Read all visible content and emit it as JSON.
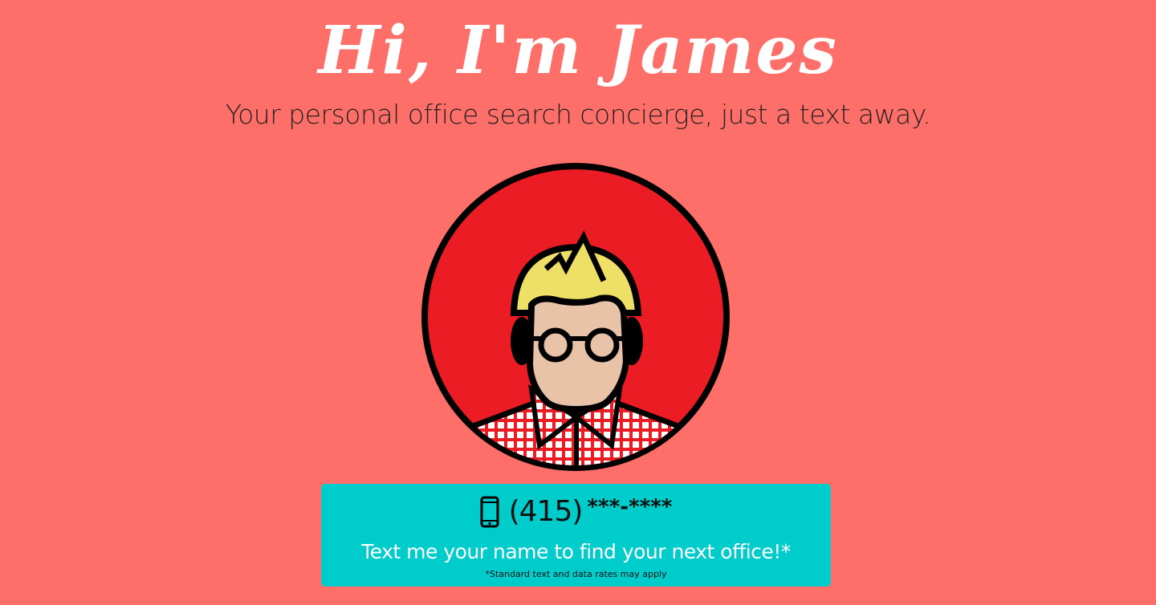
{
  "header": {
    "title": "Hi, I'm James",
    "subtitle": "Your personal office search concierge, just a text away."
  },
  "avatar": {
    "icon": "cartoon-avatar-icon"
  },
  "cta": {
    "phone_icon": "mobile-phone-icon",
    "area_code": "(415)",
    "masked_number": "***-****",
    "message": "Text me your name to find your next office!*",
    "disclaimer": "*Standard text and data rates may apply"
  },
  "colors": {
    "background": "#ff6f69",
    "cta": "#00cccc",
    "avatar_bg": "#ec1c24"
  }
}
